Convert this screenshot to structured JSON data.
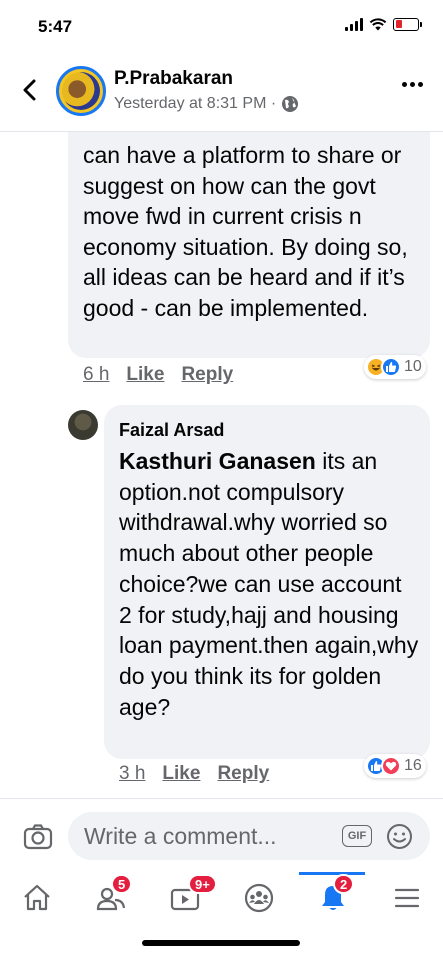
{
  "status_bar": {
    "time": "5:47"
  },
  "header": {
    "name": "P.Prabakaran",
    "meta": "Yesterday at 8:31 PM ·"
  },
  "comments": [
    {
      "text": "can have a platform to share or suggest on how can the govt move fwd in current crisis n economy situation. By doing so, all ideas can be heard and if it’s good - can be implemented.",
      "time": "6 h",
      "like_label": "Like",
      "reply_label": "Reply",
      "reactions": [
        "haha",
        "like"
      ],
      "reaction_count": "10"
    },
    {
      "author": "Faizal Arsad",
      "mention": "Kasthuri Ganasen",
      "text": " its an option.not compulsory withdrawal.why worried so much about other people choice?we can use account 2 for study,hajj and housing loan payment.then again,why do you think its for golden age?",
      "time": "3 h",
      "like_label": "Like",
      "reply_label": "Reply",
      "reactions": [
        "like",
        "love"
      ],
      "reaction_count": "16"
    }
  ],
  "composer": {
    "placeholder": "Write a comment...",
    "gif_label": "GIF"
  },
  "bottom_nav": {
    "items": [
      {
        "icon": "home-icon",
        "badge": ""
      },
      {
        "icon": "friends-icon",
        "badge": "5"
      },
      {
        "icon": "watch-icon",
        "badge": "9+"
      },
      {
        "icon": "groups-icon",
        "badge": ""
      },
      {
        "icon": "notifications-icon",
        "badge": "2"
      },
      {
        "icon": "menu-icon",
        "badge": ""
      }
    ],
    "active": "notifications-icon"
  },
  "colors": {
    "accent": "#1877f2",
    "bubble": "#f0f2f5",
    "secondary_text": "#65676b",
    "badge": "#e41e3f"
  }
}
